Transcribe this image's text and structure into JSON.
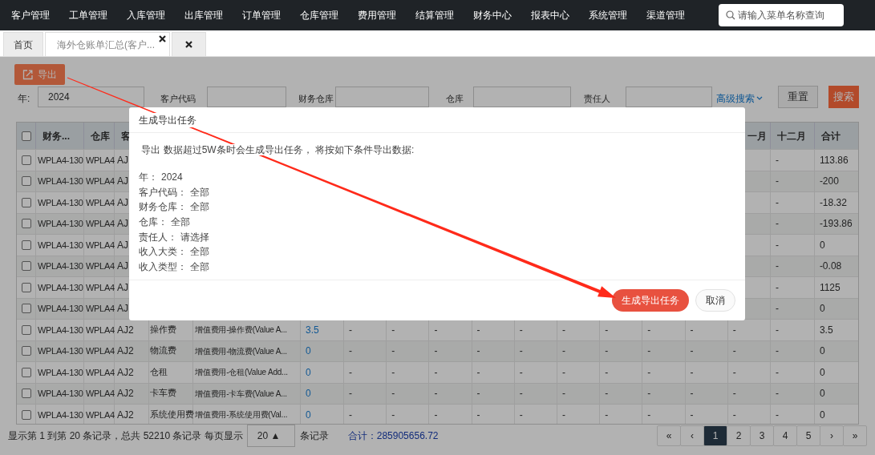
{
  "nav": {
    "items": [
      "客户管理",
      "工单管理",
      "入库管理",
      "出库管理",
      "订单管理",
      "仓库管理",
      "费用管理",
      "结算管理",
      "财务中心",
      "报表中心",
      "系统管理",
      "渠道管理"
    ],
    "search": {
      "placeholder": "请输入菜单名称查询"
    }
  },
  "tabs": [
    {
      "label": "首页",
      "selected": false,
      "closable": false
    },
    {
      "label": "海外仓账单汇总(客户...",
      "selected": true,
      "closable": true
    },
    {
      "selected": false,
      "closable": true
    }
  ],
  "toolbar": {
    "export": "导出"
  },
  "filters": {
    "year_label": "年:",
    "year_value": "2024",
    "labels": [
      "客户代码",
      "财务仓库",
      "仓库",
      "责任人"
    ],
    "advanced": "高级搜索",
    "reset": "重置",
    "search": "搜索"
  },
  "table": {
    "header_checked": false,
    "columns": [
      "财务...",
      "仓库",
      "客",
      null,
      null,
      null,
      null,
      null,
      null,
      null,
      null,
      null,
      null,
      null,
      null,
      "一月",
      "十二月",
      "合计"
    ],
    "rows": [
      {
        "checked": false,
        "cells": [
          "WPLA4-130",
          "WPLA4",
          "AJ",
          null,
          null,
          null,
          null,
          null,
          null,
          null,
          null,
          null,
          null,
          null,
          null,
          null,
          "-",
          "113.86"
        ]
      },
      {
        "checked": false,
        "cells": [
          "WPLA4-130",
          "WPLA4",
          "AJ",
          null,
          null,
          null,
          null,
          null,
          null,
          null,
          null,
          null,
          null,
          null,
          null,
          null,
          "-",
          "-200"
        ]
      },
      {
        "checked": false,
        "cells": [
          "WPLA4-130",
          "WPLA4",
          "AJ",
          null,
          null,
          null,
          null,
          null,
          null,
          null,
          null,
          null,
          null,
          null,
          null,
          null,
          "-",
          "-18.32"
        ]
      },
      {
        "checked": false,
        "cells": [
          "WPLA4-130",
          "WPLA4",
          "AJ",
          null,
          null,
          null,
          null,
          null,
          null,
          null,
          null,
          null,
          null,
          null,
          null,
          null,
          "-",
          "-193.86"
        ]
      },
      {
        "checked": false,
        "cells": [
          "WPLA4-130",
          "WPLA4",
          "AJ",
          null,
          null,
          null,
          null,
          null,
          null,
          null,
          null,
          null,
          null,
          null,
          null,
          null,
          "-",
          "0"
        ]
      },
      {
        "checked": false,
        "cells": [
          "WPLA4-130",
          "WPLA4",
          "AJ",
          null,
          null,
          null,
          null,
          null,
          null,
          null,
          null,
          null,
          null,
          null,
          null,
          null,
          "-",
          "-0.08"
        ]
      },
      {
        "checked": false,
        "cells": [
          "WPLA4-130",
          "WPLA4",
          "AJ",
          null,
          null,
          null,
          null,
          null,
          null,
          null,
          null,
          null,
          null,
          null,
          null,
          null,
          "-",
          "1125"
        ]
      },
      {
        "checked": false,
        "cells": [
          "WPLA4-130",
          "WPLA4",
          "AJ",
          null,
          null,
          null,
          null,
          null,
          null,
          null,
          null,
          null,
          null,
          null,
          null,
          null,
          "-",
          "0"
        ]
      },
      {
        "checked": false,
        "cells": [
          "WPLA4-130",
          "WPLA4",
          "AJ2",
          "操作费",
          "增值费用-操作费(Value A...",
          "3.5",
          "-",
          "-",
          "-",
          "-",
          "-",
          "-",
          "-",
          "-",
          "-",
          "-",
          "-",
          "3.5"
        ]
      },
      {
        "checked": false,
        "cells": [
          "WPLA4-130",
          "WPLA4",
          "AJ2",
          "物流费",
          "增值费用-物流费(Value A...",
          "0",
          "-",
          "-",
          "-",
          "-",
          "-",
          "-",
          "-",
          "-",
          "-",
          "-",
          "-",
          "0"
        ]
      },
      {
        "checked": false,
        "cells": [
          "WPLA4-130",
          "WPLA4",
          "AJ2",
          "仓租",
          "增值费用-仓租(Value Add...",
          "0",
          "-",
          "-",
          "-",
          "-",
          "-",
          "-",
          "-",
          "-",
          "-",
          "-",
          "-",
          "0"
        ]
      },
      {
        "checked": false,
        "cells": [
          "WPLA4-130",
          "WPLA4",
          "AJ2",
          "卡车费",
          "增值费用-卡车费(Value A...",
          "0",
          "-",
          "-",
          "-",
          "-",
          "-",
          "-",
          "-",
          "-",
          "-",
          "-",
          "-",
          "0"
        ]
      },
      {
        "checked": false,
        "cells": [
          "WPLA4-130",
          "WPLA4",
          "AJ2",
          "系统使用费",
          "增值费用-系统使用费(Val...",
          "0",
          "-",
          "-",
          "-",
          "-",
          "-",
          "-",
          "-",
          "-",
          "-",
          "-",
          "-",
          "0"
        ]
      }
    ]
  },
  "footer": {
    "summary": "显示第 1 到第 20 条记录，总共 52210 条记录 每页显示",
    "page_size": "20 ▲",
    "suffix": "条记录",
    "total": "合计：285905656.72",
    "pages": [
      {
        "label": "«",
        "selected": false
      },
      {
        "label": "‹",
        "selected": false
      },
      {
        "label": "1",
        "selected": true
      },
      {
        "label": "2",
        "selected": false
      },
      {
        "label": "3",
        "selected": false
      },
      {
        "label": "4",
        "selected": false
      },
      {
        "label": "5",
        "selected": false
      },
      {
        "label": "›",
        "selected": false
      },
      {
        "label": "»",
        "selected": false
      }
    ]
  },
  "dialog": {
    "title": "生成导出任务",
    "message": " 导出 数据超过5W条时会生成导出任务， 将按如下条件导出数据:",
    "conditions": [
      {
        "label": "年：",
        "value": "2024"
      },
      {
        "label": "客户代码：",
        "value": "全部"
      },
      {
        "label": "财务仓库：",
        "value": "全部"
      },
      {
        "label": "仓库：",
        "value": "全部"
      },
      {
        "label": "责任人：",
        "value": "请选择"
      },
      {
        "label": "收入大类：",
        "value": "全部"
      },
      {
        "label": "收入类型：",
        "value": "全部"
      }
    ],
    "confirm": "生成导出任务",
    "cancel": "取消"
  }
}
